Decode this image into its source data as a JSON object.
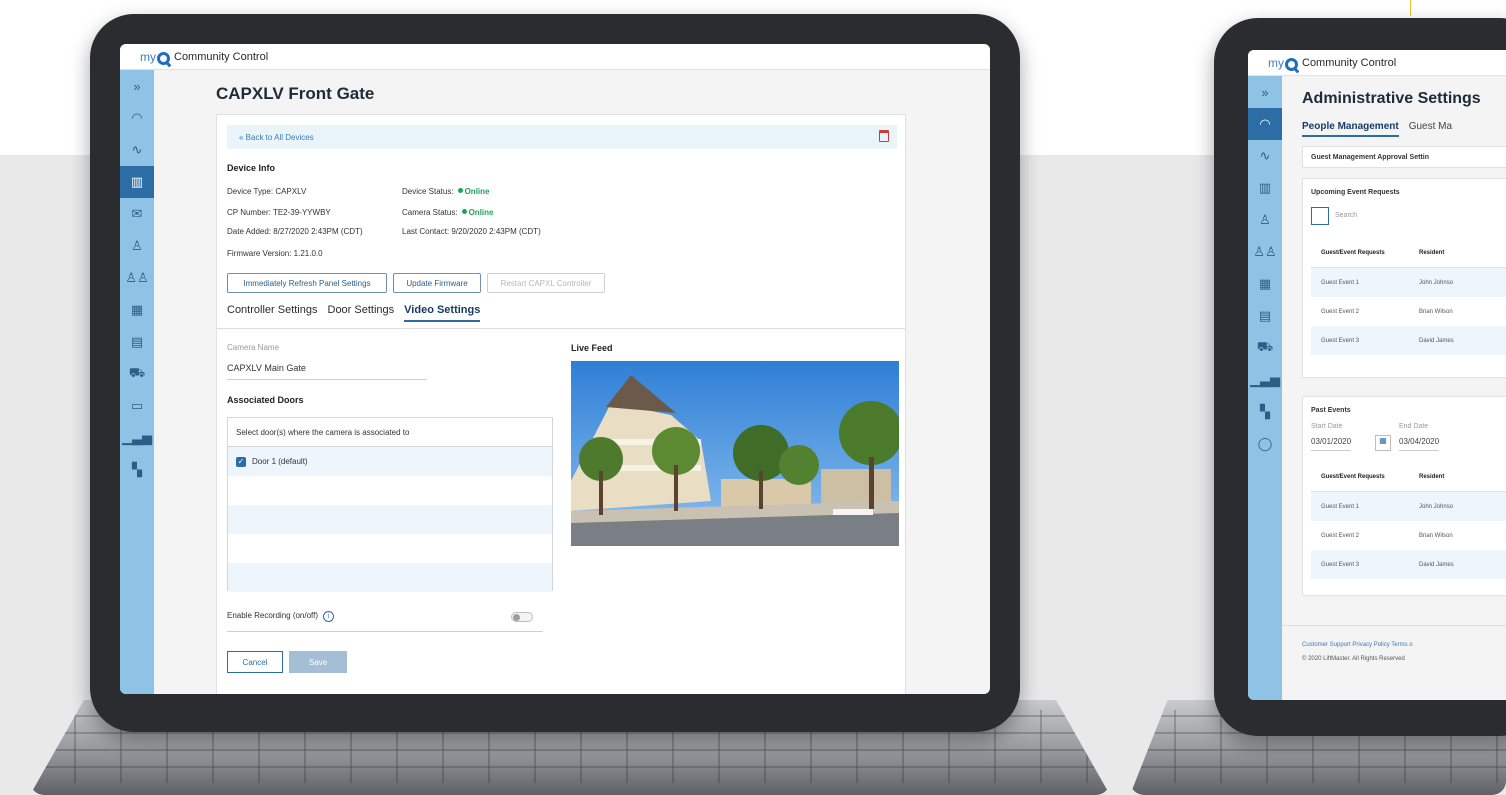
{
  "app": {
    "logo_my": "my",
    "logo_name": "Community Control"
  },
  "device_page": {
    "title": "CAPXLV Front Gate",
    "back_link": "« Back to All Devices",
    "device_info_heading": "Device Info",
    "device_type": "Device Type: CAPXLV",
    "cp_number": "CP Number: TE2-39-YYWBY",
    "date_added": "Date Added: 8/27/2020 2:43PM (CDT)",
    "firmware_version": "Firmware Version: 1.21.0.0",
    "device_status_label": "Device Status:",
    "device_status_value": "Online",
    "camera_status_label": "Camera Status:",
    "camera_status_value": "Online",
    "last_contact": "Last Contact: 9/20/2020 2:43PM (CDT)",
    "buttons": {
      "refresh": "Immediately Refresh Panel Settings",
      "update_firmware": "Update Firmware",
      "restart": "Restart CAPXL Controller"
    },
    "tabs": [
      "Controller Settings",
      "Door Settings",
      "Video Settings"
    ],
    "camera_name_label": "Camera Name",
    "camera_name_value": "CAPXLV Main Gate",
    "associated_doors_heading": "Associated Doors",
    "doors_instruction": "Select door(s) where the camera is associated to",
    "doors": [
      {
        "label": "Door 1 (default)",
        "checked": true
      }
    ],
    "live_feed_heading": "Live Feed",
    "enable_recording_label": "Enable Recording (on/off)",
    "enable_recording_on": false,
    "cancel_label": "Cancel",
    "save_label": "Save"
  },
  "admin_page": {
    "title": "Administrative Settings",
    "tabs": [
      "People Management",
      "Guest Ma"
    ],
    "approval_settings": "Guest Management Approval Settin",
    "upcoming_heading": "Upcoming Event Requests",
    "search_placeholder": "Search",
    "columns": [
      "Guest/Event Requests",
      "Resident"
    ],
    "upcoming_rows": [
      [
        "Guest Event 1",
        "John Johnso"
      ],
      [
        "Guest Event 2",
        "Brian Wilson"
      ],
      [
        "Guest Event 3",
        "David James"
      ]
    ],
    "past_heading": "Past Events",
    "start_date_label": "Start Date",
    "start_date_value": "03/01/2020",
    "end_date_label": "End Date",
    "end_date_value": "03/04/2020",
    "past_rows": [
      [
        "Guest Event 1",
        "John Johnso"
      ],
      [
        "Guest Event 2",
        "Brian Wilson"
      ],
      [
        "Guest Event 3",
        "David James"
      ]
    ],
    "footer_links": "Customer Support   Privacy Policy   Terms o",
    "copyright": "© 2020 LiftMaster. All Rights Reserved"
  },
  "colors": {
    "accent": "#2d6da5",
    "rail": "#8fc3e6",
    "online": "#21a35b",
    "danger": "#d23a3a"
  },
  "rail_icons": [
    "expand-icon",
    "dashboard-icon",
    "activity-icon",
    "building-icon",
    "mail-icon",
    "person-icon",
    "people-icon",
    "calendar-icon",
    "id-card-icon",
    "vehicle-icon",
    "card-icon",
    "report-icon",
    "community-icon",
    "chat-icon"
  ]
}
